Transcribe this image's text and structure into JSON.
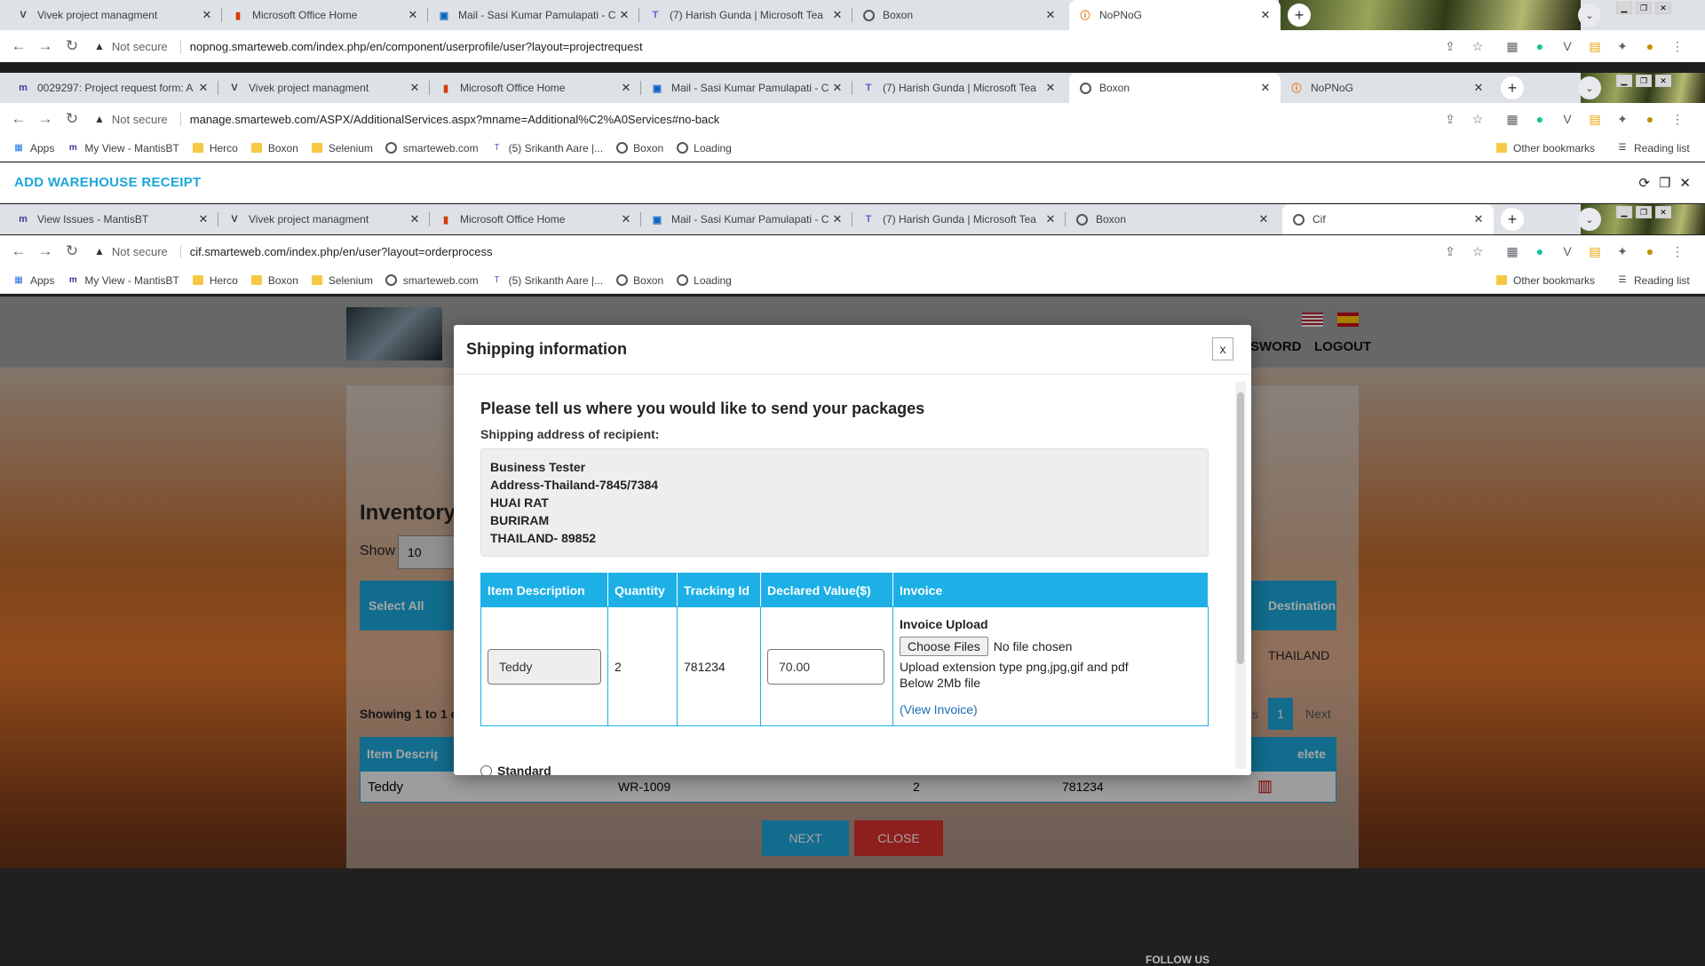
{
  "windows": [
    {
      "tabs": [
        {
          "title": "Vivek project managment",
          "icon": "V",
          "active": false
        },
        {
          "title": "Microsoft Office Home",
          "icon": "O",
          "active": false
        },
        {
          "title": "Mail - Sasi Kumar Pamulapati - C",
          "icon": "o",
          "active": false
        },
        {
          "title": "(7) Harish Gunda | Microsoft Tea",
          "icon": "T",
          "active": false
        },
        {
          "title": "Boxon",
          "icon": "globe",
          "active": false
        },
        {
          "title": "NoPNoG",
          "icon": "!",
          "active": true
        }
      ],
      "url": "nopnog.smarteweb.com/index.php/en/component/userprofile/user?layout=projectrequest"
    },
    {
      "tabs": [
        {
          "title": "0029297: Project request form: A",
          "icon": "m",
          "active": false
        },
        {
          "title": "Vivek project managment",
          "icon": "V",
          "active": false
        },
        {
          "title": "Microsoft Office Home",
          "icon": "O",
          "active": false
        },
        {
          "title": "Mail - Sasi Kumar Pamulapati - C",
          "icon": "o",
          "active": false
        },
        {
          "title": "(7) Harish Gunda | Microsoft Tea",
          "icon": "T",
          "active": false
        },
        {
          "title": "Boxon",
          "icon": "globe",
          "active": true
        },
        {
          "title": "NoPNoG",
          "icon": "!",
          "active": false
        }
      ],
      "url": "manage.smarteweb.com/ASPX/AdditionalServices.aspx?mname=Additional%C2%A0Services#no-back"
    },
    {
      "tabs": [
        {
          "title": "View Issues - MantisBT",
          "icon": "m",
          "active": false
        },
        {
          "title": "Vivek project managment",
          "icon": "V",
          "active": false
        },
        {
          "title": "Microsoft Office Home",
          "icon": "O",
          "active": false
        },
        {
          "title": "Mail - Sasi Kumar Pamulapati - C",
          "icon": "o",
          "active": false
        },
        {
          "title": "(7) Harish Gunda | Microsoft Tea",
          "icon": "T",
          "active": false
        },
        {
          "title": "Boxon",
          "icon": "globe",
          "active": false
        },
        {
          "title": "Cif",
          "icon": "globe",
          "active": true
        }
      ],
      "url": "cif.smarteweb.com/index.php/en/user?layout=orderprocess"
    }
  ],
  "not_secure": "Not secure",
  "bookmarks": [
    {
      "label": "Apps",
      "icon": "apps-icon"
    },
    {
      "label": "My View - MantisBT",
      "icon": "mantis-icon"
    },
    {
      "label": "Herco",
      "icon": "folder-icon"
    },
    {
      "label": "Boxon",
      "icon": "folder-icon"
    },
    {
      "label": "Selenium",
      "icon": "folder-icon"
    },
    {
      "label": "smarteweb.com",
      "icon": "globe-icon"
    },
    {
      "label": "(5) Srikanth Aare |...",
      "icon": "teams-icon"
    },
    {
      "label": "Boxon",
      "icon": "globe-icon"
    },
    {
      "label": "Loading",
      "icon": "globe-icon"
    }
  ],
  "other_bookmarks": "Other bookmarks",
  "reading_list": "Reading list",
  "strip_title": "ADD WAREHOUSE RECEIPT",
  "site": {
    "nav_partial": "SWORD",
    "logout": "LOGOUT",
    "inventory_title": "Inventory",
    "show_label": "Show",
    "show_value": "10",
    "select_all": "Select All",
    "destination_header": "Destination",
    "destination_value": "THAILAND",
    "showing": "Showing 1 to 1 o",
    "page_partial": "s",
    "page_current": "1",
    "next": "Next",
    "item_desc_header": "Item Descript",
    "delete_header": "elete",
    "row": {
      "desc": "Teddy",
      "wr": "WR-1009",
      "qty": "2",
      "tracking": "781234"
    },
    "next_button": "NEXT",
    "close_button": "CLOSE",
    "footer_partial": "FOLLOW US"
  },
  "modal": {
    "title": "Shipping information",
    "close": "x",
    "question": "Please tell us where you would like to send your packages",
    "address_label": "Shipping address of recipient:",
    "address_lines": [
      "Business Tester",
      "Address-Thailand-7845/7384",
      "HUAI RAT",
      "BURIRAM",
      "THAILAND- 89852"
    ],
    "table_headers": [
      "Item Description",
      "Quantity",
      "Tracking Id",
      "Declared Value($)",
      "Invoice"
    ],
    "row": {
      "description": "Teddy",
      "quantity": "2",
      "tracking": "781234",
      "declared": "70.00",
      "invoice_title": "Invoice Upload",
      "choose_files": "Choose Files",
      "no_file": "No file chosen",
      "ext_note": "Upload extension type png,jpg,gif and pdf",
      "size_note": "Below 2Mb file",
      "view_invoice": "(View Invoice)"
    },
    "shipping_option": "Standard"
  }
}
